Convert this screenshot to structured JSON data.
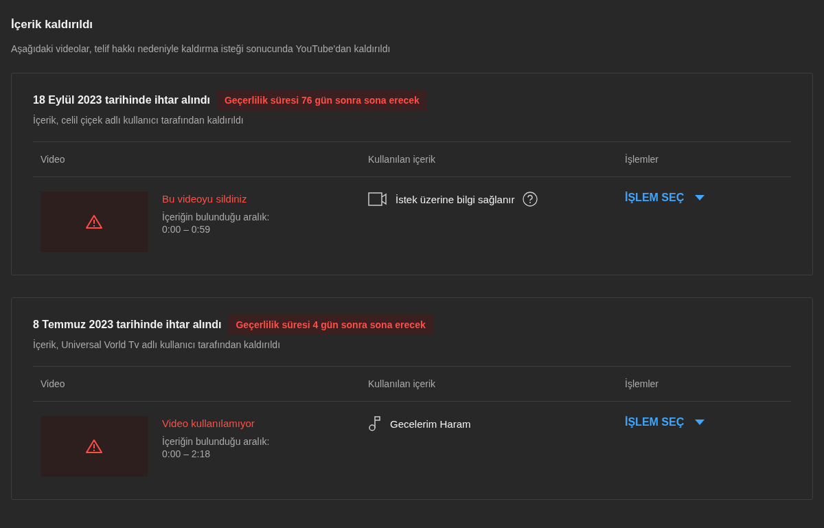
{
  "title": "İçerik kaldırıldı",
  "subtitle": "Aşağıdaki videolar, telif hakkı nedeniyle kaldırma isteği sonucunda YouTube'dan kaldırıldı",
  "strikes": [
    {
      "heading": "18 Eylül 2023 tarihinde ihtar alındı",
      "expiry": "Geçerlilik süresi 76 gün sonra sona erecek",
      "removed_by": "İçerik, celil çiçek adlı kullanıcı tarafından kaldırıldı",
      "columns": [
        "Video",
        "Kullanılan içerik",
        "İşlemler"
      ],
      "video_status": "Bu videoyu sildiniz",
      "range_label": "İçeriğin bulunduğu aralık:",
      "range": "0:00 – 0:59",
      "content": {
        "kind": "video",
        "label": "İstek üzerine bilgi sağlanır",
        "help": true
      },
      "action": "İŞLEM SEÇ"
    },
    {
      "heading": "8 Temmuz 2023 tarihinde ihtar alındı",
      "expiry": "Geçerlilik süresi 4 gün sonra sona erecek",
      "removed_by": "İçerik, Universal Vorld Tv adlı kullanıcı tarafından kaldırıldı",
      "columns": [
        "Video",
        "Kullanılan içerik",
        "İşlemler"
      ],
      "video_status": "Video kullanılamıyor",
      "range_label": "İçeriğin bulunduğu aralık:",
      "range": "0:00 – 2:18",
      "content": {
        "kind": "music",
        "label": "Gecelerim Haram"
      },
      "action": "İŞLEM SEÇ"
    }
  ]
}
